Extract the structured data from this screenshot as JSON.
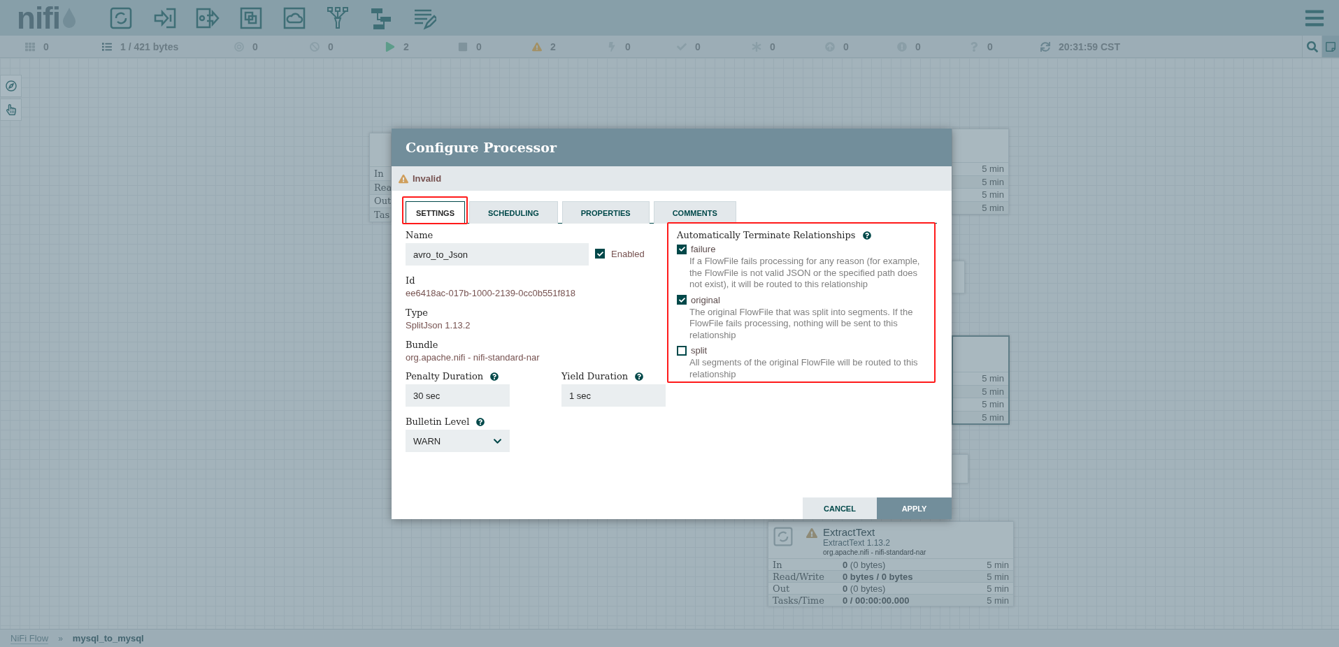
{
  "header": {
    "logo": "nifi"
  },
  "status_bar": [
    {
      "text": "0"
    },
    {
      "text": "1 / 421 bytes"
    },
    {
      "text": "0"
    },
    {
      "text": "0"
    },
    {
      "text": "2"
    },
    {
      "text": "0"
    },
    {
      "text": "2"
    },
    {
      "text": "0"
    },
    {
      "text": "0"
    },
    {
      "text": "0"
    },
    {
      "text": "0"
    },
    {
      "text": "0"
    },
    {
      "text": "0"
    },
    {
      "text": "20:31:59 CST"
    }
  ],
  "canvas_nodes": [
    {
      "kind": "left-edge",
      "selected": false,
      "rows": [
        {
          "label": "In"
        },
        {
          "label": "Rea"
        },
        {
          "label": "Out"
        },
        {
          "label": "Tas"
        }
      ]
    },
    {
      "kind": "right-edge",
      "selected": false,
      "rows": [
        {
          "period": "5 min"
        },
        {
          "period": "5 min"
        },
        {
          "period": "5 min"
        },
        {
          "period": "5 min"
        }
      ]
    },
    {
      "kind": "right-edge",
      "selected": false
    },
    {
      "kind": "right-edge",
      "selected": true,
      "rows": [
        {
          "period": "5 min"
        },
        {
          "period": "5 min"
        },
        {
          "period": "5 min"
        },
        {
          "period": "5 min"
        }
      ]
    },
    {
      "kind": "right-edge",
      "selected": false
    },
    {
      "kind": "processor",
      "selected": false,
      "name": "ExtractText",
      "type": "ExtractText 1.13.2",
      "bundle": "org.apache.nifi - nifi-standard-nar",
      "rows": [
        {
          "label": "In",
          "value": "0",
          "detail": "(0 bytes)",
          "period": "5 min"
        },
        {
          "label": "Read/Write",
          "value": "0 bytes / 0 bytes",
          "period": "5 min"
        },
        {
          "label": "Out",
          "value": "0",
          "detail": "(0 bytes)",
          "period": "5 min"
        },
        {
          "label": "Tasks/Time",
          "value": "0 / 00:00:00.000",
          "period": "5 min"
        }
      ]
    }
  ],
  "breadcrumb": {
    "items": [
      {
        "label": "NiFi Flow",
        "selected": false
      },
      {
        "label": "mysql_to_mysql",
        "selected": true
      }
    ],
    "separator": "»"
  },
  "dialog": {
    "title": "Configure Processor",
    "status": "Invalid",
    "tabs": [
      {
        "label": "SETTINGS",
        "selected": true
      },
      {
        "label": "SCHEDULING",
        "selected": false
      },
      {
        "label": "PROPERTIES",
        "selected": false
      },
      {
        "label": "COMMENTS",
        "selected": false
      }
    ],
    "name": {
      "label": "Name",
      "value": "avro_to_Json"
    },
    "enabled": {
      "label": "Enabled",
      "checked": true
    },
    "id": {
      "label": "Id",
      "value": "ee6418ac-017b-1000-2139-0cc0b551f818"
    },
    "type": {
      "label": "Type",
      "value": "SplitJson 1.13.2"
    },
    "bundle": {
      "label": "Bundle",
      "value": "org.apache.nifi - nifi-standard-nar"
    },
    "penalty": {
      "label": "Penalty Duration",
      "value": "30 sec"
    },
    "yield": {
      "label": "Yield Duration",
      "value": "1 sec"
    },
    "bulletin": {
      "label": "Bulletin Level",
      "value": "WARN"
    },
    "relationships_title": "Automatically Terminate Relationships",
    "relationships": [
      {
        "name": "failure",
        "checked": true,
        "description": "If a FlowFile fails processing for any reason (for example, the FlowFile is not valid JSON or the specified path does not exist), it will be routed to this relationship"
      },
      {
        "name": "original",
        "checked": true,
        "description": "The original FlowFile that was split into segments. If the FlowFile fails processing, nothing will be sent to this relationship"
      },
      {
        "name": "split",
        "checked": false,
        "description": "All segments of the original FlowFile will be routed to this relationship"
      }
    ],
    "buttons": [
      {
        "label": "CANCEL",
        "kind": "secondary"
      },
      {
        "label": "APPLY",
        "kind": "primary"
      }
    ]
  }
}
